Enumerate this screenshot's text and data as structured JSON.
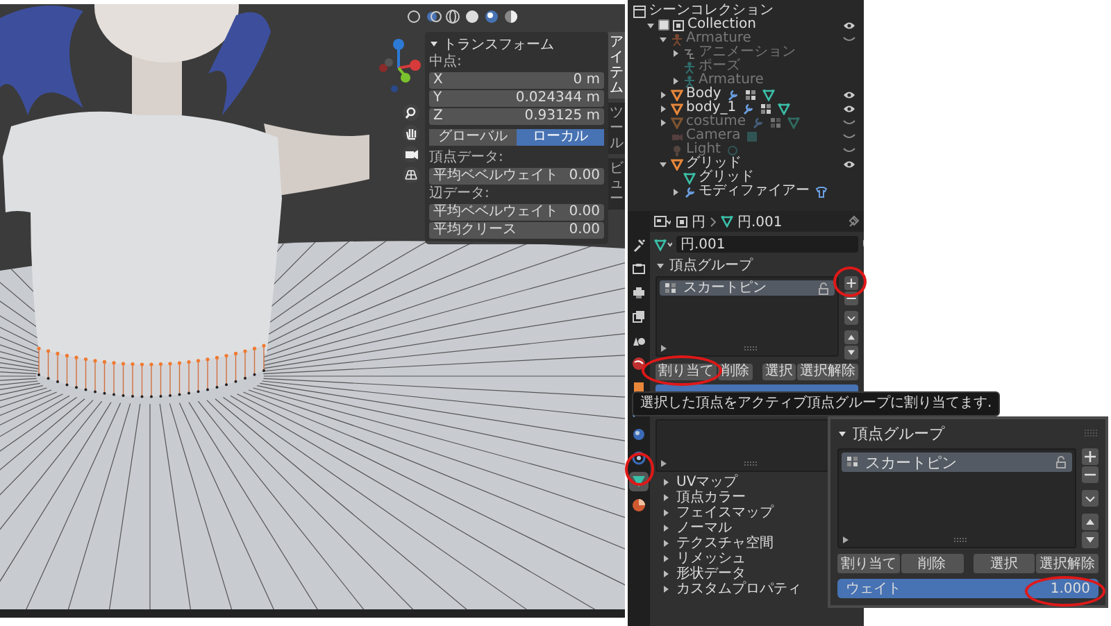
{
  "viewport": {
    "side_tabs": [
      {
        "label": "アイテム",
        "selected": true
      },
      {
        "label": "ツール",
        "selected": false
      },
      {
        "label": "ビュー",
        "selected": false
      }
    ],
    "transform_panel": {
      "title": "トランスフォーム",
      "expanded": true,
      "median_label": "中点:",
      "coordinates": [
        {
          "axis": "X",
          "value": "0 m"
        },
        {
          "axis": "Y",
          "value": "0.024344 m"
        },
        {
          "axis": "Z",
          "value": "0.93125 m"
        }
      ],
      "space_toggle": [
        {
          "label": "グローバル",
          "selected": false
        },
        {
          "label": "ローカル",
          "selected": true
        }
      ],
      "vertex_data": {
        "heading": "頂点データ:",
        "fields": [
          {
            "label": "平均ベベルウェイト",
            "value": "0.00"
          }
        ]
      },
      "edge_data": {
        "heading": "辺データ:",
        "fields": [
          {
            "label": "平均ベベルウェイト",
            "value": "0.00"
          },
          {
            "label": "平均クリース",
            "value": "0.00"
          }
        ]
      }
    }
  },
  "outliner": {
    "root": "シーンコレクション",
    "items": [
      {
        "label": "Collection",
        "kind": "collection",
        "expanded": true,
        "checked": true,
        "visible": true,
        "children": [
          {
            "label": "Armature",
            "kind": "armature",
            "expanded": true,
            "visible": false,
            "children": [
              {
                "label": "アニメーション",
                "kind": "action",
                "expanded": false
              },
              {
                "label": "ポーズ",
                "kind": "pose"
              },
              {
                "label": "Armature",
                "kind": "armature-data",
                "expanded": false
              }
            ]
          },
          {
            "label": "Body",
            "kind": "mesh",
            "expanded": false,
            "visible": true
          },
          {
            "label": "body_1",
            "kind": "mesh",
            "expanded": false,
            "visible": true
          },
          {
            "label": "costume",
            "kind": "mesh",
            "expanded": false,
            "visible": false
          },
          {
            "label": "Camera",
            "kind": "camera",
            "visible": false
          },
          {
            "label": "Light",
            "kind": "light",
            "visible": false
          },
          {
            "label": "グリッド",
            "kind": "mesh",
            "expanded": true,
            "visible": true,
            "children": [
              {
                "label": "グリッド",
                "kind": "mesh-data"
              },
              {
                "label": "モディファイアー",
                "kind": "modifier",
                "expanded": false
              }
            ]
          }
        ]
      }
    ]
  },
  "properties": {
    "tabs": [
      {
        "kind": "tool",
        "selected": false
      },
      {
        "kind": "render",
        "selected": false
      },
      {
        "kind": "output",
        "selected": false
      },
      {
        "kind": "view-layer",
        "selected": false
      },
      {
        "kind": "scene",
        "selected": false
      },
      {
        "kind": "world",
        "selected": false
      },
      {
        "kind": "object",
        "selected": false
      },
      {
        "kind": "modifier",
        "selected": false
      },
      {
        "kind": "particles",
        "selected": false
      },
      {
        "kind": "physics",
        "selected": false
      },
      {
        "kind": "data",
        "selected": true
      },
      {
        "kind": "material",
        "selected": false
      }
    ],
    "breadcrumb": [
      {
        "kind": "object",
        "label": "円"
      },
      {
        "kind": "mesh",
        "label": "円.001"
      }
    ],
    "mesh_name": "円.001",
    "vertex_groups": {
      "title": "頂点グループ",
      "expanded": true,
      "groups": [
        {
          "name": "スカートピン",
          "selected": true
        }
      ],
      "buttons": [
        "割り当て",
        "削除",
        "選択",
        "選択解除"
      ],
      "weight": {
        "level": 1
      }
    },
    "tooltip": "選択した頂点をアクティブ頂点グループに割り当てます.",
    "collapsed_panels": [
      {
        "label": "UVマップ",
        "expanded": false
      },
      {
        "label": "頂点カラー",
        "expanded": false
      },
      {
        "label": "フェイスマップ",
        "expanded": false
      },
      {
        "label": "ノーマル",
        "expanded": false
      },
      {
        "label": "テクスチャ空間",
        "expanded": false
      },
      {
        "label": "リメッシュ",
        "expanded": false
      },
      {
        "label": "形状データ",
        "expanded": false
      },
      {
        "label": "カスタムプロパティ",
        "expanded": false
      }
    ]
  },
  "inset": {
    "title": "頂点グループ",
    "expanded": true,
    "groups": [
      {
        "name": "スカートピン",
        "selected": true
      }
    ],
    "buttons": [
      "割り当て",
      "削除",
      "選択",
      "選択解除"
    ],
    "weight": {
      "label": "ウェイト",
      "value": "1.000",
      "level": 1
    }
  }
}
